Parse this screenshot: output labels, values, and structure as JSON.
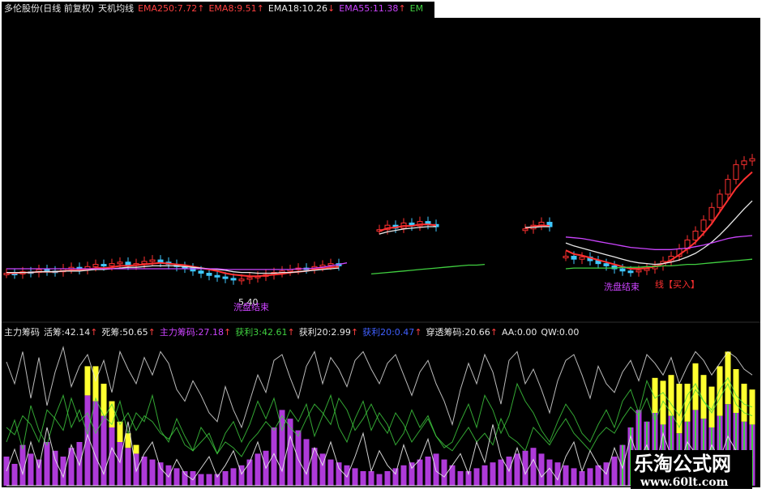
{
  "upper_header": [
    {
      "text": "多伦股份(日线 前复权)",
      "color": "#e8e8e8",
      "arrow": ""
    },
    {
      "text": "天机均线",
      "color": "#e8e8e8",
      "arrow": ""
    },
    {
      "text": "EMA250:7.72",
      "color": "#ff4040",
      "arrow": "↑"
    },
    {
      "text": "EMA8:9.51",
      "color": "#ff4040",
      "arrow": "↑"
    },
    {
      "text": "EMA18:10.26",
      "color": "#e8e8e8",
      "arrow": "↓"
    },
    {
      "text": "EMA55:11.38",
      "color": "#cc44ff",
      "arrow": "↑"
    },
    {
      "text": "EM",
      "color": "#40d040",
      "arrow": ""
    }
  ],
  "lower_header": [
    {
      "text": "主力筹码",
      "color": "#e8e8e8",
      "arrow": ""
    },
    {
      "text": "活筹:42.14",
      "color": "#e8e8e8",
      "arrow": "↑"
    },
    {
      "text": "死筹:50.65",
      "color": "#e8e8e8",
      "arrow": "↑"
    },
    {
      "text": "主力筹码:27.18",
      "color": "#cc44ff",
      "arrow": "↑"
    },
    {
      "text": "获利3:42.61",
      "color": "#40d040",
      "arrow": "↑"
    },
    {
      "text": "获利20:2.99",
      "color": "#e8e8e8",
      "arrow": "↑"
    },
    {
      "text": "获利20:0.47",
      "color": "#4060ff",
      "arrow": "↑"
    },
    {
      "text": "穿透筹码:20.66",
      "color": "#e8e8e8",
      "arrow": "↑"
    },
    {
      "text": "AA:0.00",
      "color": "#e8e8e8",
      "arrow": ""
    },
    {
      "text": "QW:0.00",
      "color": "#e8e8e8",
      "arrow": ""
    }
  ],
  "annotations": {
    "low_price": "5.40",
    "washout_end_1": "洗盘结束",
    "washout_end_2": "洗盘结束",
    "buy_label": "线【买入】"
  },
  "watermark": {
    "title": "乐淘公式网",
    "url": "www.60lt.com"
  },
  "colors": {
    "background": "#000000",
    "up_candle": "#ff3030",
    "down_candle": "#40c8ff",
    "ema8": "#ff3030",
    "ema18": "#e8e8e8",
    "ema55": "#cc44ff",
    "ema250": "#40d040",
    "chip_yellow": "#ffff30",
    "chip_purple": "#cc44ff",
    "chip_green": "#40d040",
    "chip_white": "#e8e8e8"
  },
  "chart_data": {
    "type": "line",
    "ylim": [
      0,
      40
    ],
    "x": [
      0,
      1,
      2,
      3,
      4,
      5,
      6,
      7,
      8,
      9,
      10,
      11,
      12,
      13,
      14,
      15,
      16,
      17,
      18,
      19,
      20,
      21,
      22,
      23,
      24,
      25,
      26,
      27,
      28,
      29,
      30,
      31,
      32,
      33,
      34,
      35,
      36,
      37,
      38,
      39,
      40,
      41,
      42,
      43,
      44,
      45,
      46,
      47,
      48,
      49,
      50,
      51,
      52,
      53,
      54,
      55,
      56,
      57,
      58,
      59,
      60,
      61,
      62,
      63,
      64,
      65,
      66,
      67,
      68,
      69,
      70,
      71,
      72,
      73,
      74,
      75,
      76,
      77,
      78,
      79,
      80,
      81,
      82,
      83,
      84,
      85,
      86,
      87,
      88,
      89,
      90,
      91,
      92
    ],
    "close": [
      6.3,
      6.2,
      6.5,
      6.4,
      6.8,
      6.6,
      6.5,
      6.9,
      7.1,
      6.8,
      7.2,
      7.5,
      7.3,
      7.6,
      7.8,
      7.4,
      7.6,
      7.9,
      8.1,
      7.8,
      7.5,
      7.2,
      7.0,
      6.6,
      6.3,
      6.0,
      5.8,
      5.6,
      5.4,
      5.5,
      5.7,
      5.9,
      6.1,
      6.4,
      6.6,
      6.8,
      7.0,
      6.9,
      7.2,
      7.4,
      7.6,
      7.3,
      null,
      null,
      null,
      null,
      12.2,
      12.8,
      12.4,
      13.1,
      12.7,
      13.3,
      12.9,
      12.6,
      null,
      null,
      null,
      null,
      null,
      null,
      null,
      null,
      null,
      null,
      12.3,
      12.8,
      13.2,
      12.6,
      null,
      8.6,
      8.2,
      8.5,
      8.0,
      7.6,
      7.3,
      6.9,
      6.6,
      6.5,
      6.7,
      6.9,
      7.3,
      7.9,
      8.6,
      9.6,
      10.8,
      12.0,
      13.5,
      15.2,
      17.0,
      19.0,
      21.0,
      21.5,
      21.8
    ],
    "series": [
      {
        "name": "EMA8",
        "values": [
          6.3,
          6.3,
          6.4,
          6.4,
          6.5,
          6.5,
          6.5,
          6.6,
          6.7,
          6.7,
          6.8,
          7.0,
          7.0,
          7.1,
          7.3,
          7.3,
          7.4,
          7.5,
          7.6,
          7.7,
          7.6,
          7.5,
          7.4,
          7.2,
          7.0,
          6.8,
          6.6,
          6.3,
          6.1,
          6.0,
          5.9,
          5.9,
          6.0,
          6.1,
          6.2,
          6.4,
          6.5,
          6.6,
          6.8,
          6.9,
          7.1,
          7.2,
          null,
          null,
          null,
          null,
          12.0,
          12.4,
          12.5,
          12.7,
          12.7,
          12.9,
          12.9,
          12.8,
          null,
          null,
          null,
          null,
          null,
          null,
          null,
          null,
          null,
          null,
          12.4,
          12.6,
          12.8,
          12.7,
          null,
          9.4,
          8.9,
          8.7,
          8.4,
          8.1,
          7.8,
          7.5,
          7.2,
          6.9,
          6.9,
          7.0,
          7.2,
          7.6,
          8.1,
          8.8,
          9.6,
          10.5,
          11.7,
          13.0,
          14.6,
          16.2,
          17.8,
          19.0,
          20.0
        ]
      },
      {
        "name": "EMA18",
        "values": [
          6.4,
          6.4,
          6.4,
          6.4,
          6.5,
          6.5,
          6.5,
          6.6,
          6.6,
          6.6,
          6.7,
          6.8,
          6.8,
          6.9,
          7.0,
          7.1,
          7.1,
          7.2,
          7.3,
          7.3,
          7.3,
          7.3,
          7.2,
          7.1,
          7.0,
          6.9,
          6.8,
          6.7,
          6.5,
          6.4,
          6.4,
          6.3,
          6.3,
          6.3,
          6.4,
          6.4,
          6.5,
          6.6,
          6.7,
          6.8,
          6.9,
          7.0,
          null,
          null,
          null,
          null,
          11.6,
          11.9,
          12.1,
          12.3,
          12.4,
          12.5,
          12.6,
          12.6,
          null,
          null,
          null,
          null,
          null,
          null,
          null,
          null,
          null,
          null,
          12.5,
          12.5,
          12.6,
          12.6,
          null,
          10.4,
          10.0,
          9.7,
          9.4,
          9.1,
          8.8,
          8.5,
          8.2,
          7.9,
          7.7,
          7.6,
          7.5,
          7.6,
          7.8,
          8.1,
          8.5,
          9.0,
          9.7,
          10.5,
          11.5,
          12.6,
          13.8,
          15.0,
          16.1
        ]
      },
      {
        "name": "EMA55",
        "values": [
          6.9,
          6.9,
          6.9,
          6.9,
          6.9,
          6.9,
          6.9,
          6.9,
          6.9,
          6.9,
          6.9,
          6.9,
          6.9,
          6.9,
          6.9,
          6.9,
          6.9,
          6.9,
          6.9,
          6.9,
          6.9,
          6.9,
          6.9,
          6.9,
          6.9,
          6.9,
          6.9,
          6.8,
          6.8,
          6.8,
          6.8,
          6.8,
          6.8,
          6.8,
          6.8,
          6.8,
          6.9,
          6.9,
          7.0,
          7.1,
          7.3,
          7.5,
          7.7,
          null,
          null,
          null,
          null,
          null,
          null,
          null,
          null,
          null,
          null,
          null,
          null,
          null,
          null,
          null,
          null,
          null,
          null,
          null,
          null,
          null,
          null,
          null,
          null,
          null,
          null,
          11.2,
          11.1,
          11.0,
          10.8,
          10.6,
          10.4,
          10.2,
          10.0,
          9.8,
          9.7,
          9.6,
          9.5,
          9.5,
          9.5,
          9.6,
          9.7,
          9.9,
          10.1,
          10.4,
          10.7,
          11.0,
          11.2,
          11.3,
          11.4
        ]
      },
      {
        "name": "EMA250",
        "values": [
          null,
          null,
          null,
          null,
          null,
          null,
          null,
          null,
          null,
          null,
          null,
          null,
          null,
          null,
          null,
          null,
          null,
          null,
          null,
          null,
          null,
          null,
          null,
          null,
          null,
          null,
          null,
          null,
          null,
          null,
          null,
          null,
          null,
          null,
          null,
          null,
          null,
          null,
          null,
          null,
          null,
          null,
          null,
          null,
          null,
          6.2,
          6.3,
          6.4,
          6.5,
          6.6,
          6.7,
          6.8,
          6.9,
          7.0,
          7.1,
          7.2,
          7.3,
          7.4,
          7.4,
          7.5,
          null,
          null,
          null,
          null,
          null,
          null,
          null,
          null,
          null,
          6.9,
          7.0,
          7.0,
          7.0,
          7.0,
          7.0,
          7.0,
          7.1,
          7.1,
          7.1,
          7.2,
          7.2,
          7.3,
          7.3,
          7.4,
          7.5,
          7.5,
          7.6,
          7.7,
          7.8,
          7.9,
          8.0,
          8.1,
          8.2
        ]
      }
    ],
    "lower_panel": {
      "ylim": [
        0,
        100
      ],
      "series": [
        {
          "name": "活筹",
          "values": [
            85,
            70,
            92,
            60,
            88,
            55,
            78,
            95,
            68,
            82,
            90,
            72,
            86,
            64,
            92,
            80,
            70,
            88,
            76,
            92,
            84,
            66,
            58,
            72,
            62,
            50,
            44,
            68,
            52,
            40,
            58,
            76,
            64,
            86,
            90,
            74,
            60,
            82,
            92,
            70,
            88,
            80,
            68,
            86,
            92,
            80,
            70,
            84,
            90,
            76,
            62,
            78,
            86,
            70,
            58,
            42,
            66,
            84,
            70,
            90,
            78,
            56,
            86,
            92,
            70,
            80,
            66,
            50,
            72,
            86,
            90,
            76,
            60,
            82,
            70,
            64,
            78,
            86,
            72,
            90,
            84,
            76,
            88,
            70,
            82,
            92,
            86,
            76,
            84,
            92,
            88,
            80,
            76
          ]
        },
        {
          "name": "死筹",
          "values": [
            40,
            35,
            48,
            42,
            30,
            52,
            46,
            38,
            60,
            44,
            50,
            36,
            46,
            56,
            42,
            50,
            38,
            48,
            44,
            36,
            32,
            40,
            28,
            24,
            30,
            36,
            22,
            30,
            26,
            20,
            30,
            36,
            44,
            38,
            48,
            40,
            34,
            46,
            56,
            50,
            42,
            60,
            52,
            38,
            46,
            56,
            44,
            36,
            50,
            42,
            30,
            38,
            46,
            34,
            28,
            24,
            32,
            40,
            30,
            36,
            28,
            46,
            34,
            30,
            24,
            40,
            34,
            28,
            38,
            46,
            36,
            30,
            24,
            34,
            40,
            36,
            46,
            54,
            48,
            60,
            44,
            58,
            50,
            40,
            54,
            66,
            58,
            50,
            60,
            70,
            56,
            50,
            48
          ]
        },
        {
          "name": "主力筹码",
          "values": [
            20,
            15,
            28,
            22,
            18,
            30,
            24,
            20,
            26,
            30,
            62,
            58,
            48,
            40,
            30,
            26,
            22,
            20,
            18,
            16,
            14,
            12,
            10,
            10,
            8,
            8,
            8,
            10,
            12,
            14,
            18,
            22,
            24,
            40,
            52,
            46,
            38,
            32,
            26,
            22,
            18,
            16,
            14,
            12,
            10,
            10,
            8,
            10,
            12,
            14,
            16,
            18,
            20,
            22,
            18,
            14,
            10,
            10,
            12,
            14,
            16,
            18,
            20,
            22,
            24,
            26,
            22,
            18,
            16,
            14,
            12,
            10,
            12,
            14,
            16,
            20,
            28,
            40,
            52,
            44,
            50,
            42,
            48,
            36,
            44,
            52,
            46,
            40,
            48,
            56,
            50,
            44,
            42
          ]
        },
        {
          "name": "获利3",
          "values": [
            30,
            45,
            25,
            55,
            38,
            28,
            48,
            62,
            40,
            52,
            35,
            60,
            48,
            42,
            58,
            36,
            50,
            44,
            62,
            38,
            30,
            46,
            34,
            24,
            40,
            32,
            22,
            36,
            44,
            30,
            42,
            58,
            46,
            60,
            38,
            52,
            44,
            56,
            34,
            48,
            62,
            40,
            30,
            46,
            58,
            38,
            50,
            42,
            28,
            36,
            52,
            40,
            48,
            34,
            26,
            30,
            44,
            56,
            40,
            62,
            52,
            36,
            48,
            70,
            58,
            50,
            38,
            30,
            44,
            56,
            48,
            36,
            30,
            42,
            52,
            40,
            58,
            66,
            50,
            72,
            60,
            64,
            56,
            48,
            62,
            70,
            58,
            52,
            66,
            74,
            62,
            56,
            54
          ]
        },
        {
          "name": "获利20",
          "values": [
            10,
            25,
            8,
            30,
            12,
            40,
            18,
            6,
            28,
            14,
            35,
            20,
            8,
            26,
            16,
            44,
            10,
            22,
            30,
            12,
            6,
            18,
            8,
            4,
            12,
            20,
            6,
            14,
            24,
            8,
            16,
            30,
            12,
            22,
            10,
            34,
            18,
            8,
            26,
            14,
            30,
            12,
            6,
            20,
            36,
            10,
            24,
            14,
            8,
            28,
            12,
            18,
            32,
            10,
            6,
            14,
            22,
            8,
            30,
            16,
            42,
            20,
            10,
            26,
            8,
            18,
            6,
            12,
            4,
            20,
            30,
            10,
            24,
            14,
            8,
            26,
            12,
            34,
            18,
            28,
            10,
            36,
            20,
            14,
            30,
            22,
            12,
            28,
            18,
            34,
            24,
            16,
            20
          ]
        },
        {
          "name": "穿透筹码",
          "values": [
            0,
            0,
            0,
            0,
            0,
            0,
            0,
            0,
            0,
            0,
            20,
            24,
            22,
            18,
            14,
            10,
            6,
            0,
            0,
            0,
            0,
            0,
            0,
            0,
            0,
            0,
            0,
            0,
            0,
            0,
            0,
            0,
            0,
            0,
            0,
            0,
            0,
            0,
            0,
            0,
            0,
            0,
            0,
            0,
            0,
            0,
            0,
            0,
            0,
            0,
            0,
            0,
            0,
            0,
            0,
            0,
            0,
            0,
            0,
            0,
            0,
            0,
            0,
            0,
            0,
            0,
            0,
            0,
            0,
            0,
            0,
            0,
            0,
            0,
            0,
            0,
            0,
            0,
            0,
            0,
            24,
            30,
            28,
            34,
            26,
            32,
            30,
            28,
            34,
            36,
            30,
            26,
            24
          ]
        }
      ]
    }
  }
}
